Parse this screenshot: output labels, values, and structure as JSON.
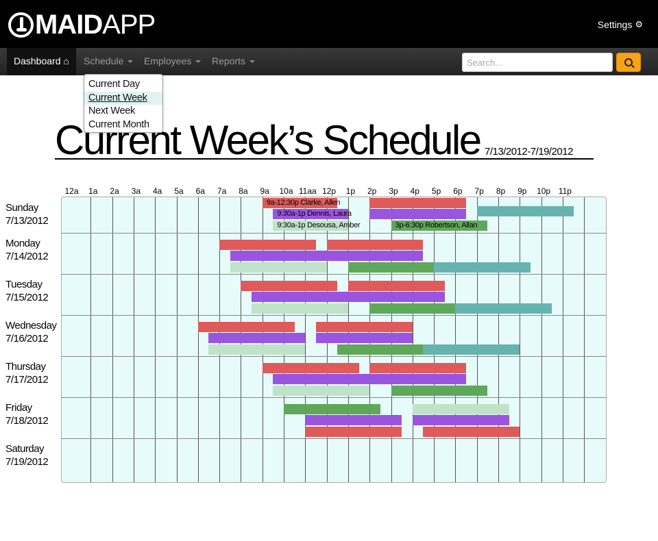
{
  "brand": {
    "name_bold": "MAID",
    "name_light": "APP"
  },
  "header": {
    "settings_label": "Settings",
    "settings_icon": "gear-icon"
  },
  "nav": {
    "items": [
      {
        "label": "Dashboard",
        "icon": "home-icon",
        "active": true
      },
      {
        "label": "Schedule",
        "has_caret": true
      },
      {
        "label": "Employees",
        "has_caret": true
      },
      {
        "label": "Reports",
        "has_caret": true
      }
    ],
    "search_placeholder": "Search...",
    "search_icon": "search-icon"
  },
  "schedule_menu": {
    "items": [
      {
        "label": "Current Day"
      },
      {
        "label": "Current Week",
        "selected": true
      },
      {
        "label": "Next Week"
      },
      {
        "label": "Current Month"
      }
    ]
  },
  "page": {
    "title": "Current Week’s Schedule",
    "date_range": "7/13/2012-7/19/2012"
  },
  "hours": [
    "12a",
    "1a",
    "2a",
    "3a",
    "4a",
    "5a",
    "6a",
    "7a",
    "8a",
    "9a",
    "10a",
    "11aa",
    "12p",
    "1p",
    "2p",
    "3p",
    "4p",
    "5p",
    "6p",
    "7p",
    "8p",
    "9p",
    "10p",
    "11p"
  ],
  "colors": {
    "red": "#e05a5a",
    "purple": "#9a55e0",
    "lightgreen": "#bfe3c8",
    "green": "#5fa85a",
    "teal": "#66b3b0",
    "grid_bg": "#e8fbfb"
  },
  "days": [
    {
      "name": "Sunday",
      "date": "7/13/2012",
      "shifts": [
        {
          "start": 9,
          "end": 12.5,
          "color": "red",
          "label": "9a-12:30p Clarke, Allen"
        },
        {
          "start": 9.5,
          "end": 13,
          "color": "purple",
          "label": "9:30a-1p Dennis, Laura"
        },
        {
          "start": 9.5,
          "end": 13,
          "color": "lightgreen",
          "label": "9:30a-1p Desousa, Amber"
        },
        {
          "start": 14,
          "end": 18.5,
          "color": "red",
          "label": ""
        },
        {
          "start": 14,
          "end": 18.5,
          "color": "purple",
          "label": ""
        },
        {
          "start": 15,
          "end": 19.5,
          "color": "green",
          "label": "3p-6:30p Robertson, Allan"
        },
        {
          "start": 19,
          "end": 23.5,
          "color": "teal",
          "label": ""
        }
      ]
    },
    {
      "name": "Monday",
      "date": "7/14/2012",
      "shifts": [
        {
          "start": 7,
          "end": 11.5,
          "color": "red",
          "label": ""
        },
        {
          "start": 7.5,
          "end": 12,
          "color": "purple",
          "label": ""
        },
        {
          "start": 7.5,
          "end": 12,
          "color": "lightgreen",
          "label": ""
        },
        {
          "start": 12,
          "end": 16.5,
          "color": "red",
          "label": ""
        },
        {
          "start": 12,
          "end": 16.5,
          "color": "purple",
          "label": ""
        },
        {
          "start": 13,
          "end": 17.5,
          "color": "green",
          "label": ""
        },
        {
          "start": 17,
          "end": 21.5,
          "color": "teal",
          "label": ""
        }
      ]
    },
    {
      "name": "Tuesday",
      "date": "7/15/2012",
      "shifts": [
        {
          "start": 8,
          "end": 12.5,
          "color": "red",
          "label": ""
        },
        {
          "start": 8.5,
          "end": 13,
          "color": "purple",
          "label": ""
        },
        {
          "start": 8.5,
          "end": 13,
          "color": "lightgreen",
          "label": ""
        },
        {
          "start": 13,
          "end": 17.5,
          "color": "red",
          "label": ""
        },
        {
          "start": 13,
          "end": 17.5,
          "color": "purple",
          "label": ""
        },
        {
          "start": 14,
          "end": 18.5,
          "color": "green",
          "label": ""
        },
        {
          "start": 18,
          "end": 22.5,
          "color": "teal",
          "label": ""
        }
      ]
    },
    {
      "name": "Wednesday",
      "date": "7/16/2012",
      "shifts": [
        {
          "start": 6,
          "end": 10.5,
          "color": "red",
          "label": ""
        },
        {
          "start": 6.5,
          "end": 11,
          "color": "purple",
          "label": ""
        },
        {
          "start": 6.5,
          "end": 11,
          "color": "lightgreen",
          "label": ""
        },
        {
          "start": 11.5,
          "end": 16,
          "color": "red",
          "label": ""
        },
        {
          "start": 11.5,
          "end": 16,
          "color": "purple",
          "label": ""
        },
        {
          "start": 12.5,
          "end": 17,
          "color": "green",
          "label": ""
        },
        {
          "start": 16.5,
          "end": 21,
          "color": "teal",
          "label": ""
        }
      ]
    },
    {
      "name": "Thursday",
      "date": "7/17/2012",
      "shifts": [
        {
          "start": 9,
          "end": 13.5,
          "color": "red",
          "label": ""
        },
        {
          "start": 9.5,
          "end": 14,
          "color": "purple",
          "label": ""
        },
        {
          "start": 9.5,
          "end": 14,
          "color": "lightgreen",
          "label": ""
        },
        {
          "start": 14,
          "end": 18.5,
          "color": "red",
          "label": ""
        },
        {
          "start": 14,
          "end": 18.5,
          "color": "purple",
          "label": ""
        },
        {
          "start": 15,
          "end": 19.5,
          "color": "green",
          "label": ""
        }
      ]
    },
    {
      "name": "Friday",
      "date": "7/18/2012",
      "shifts": [
        {
          "start": 10,
          "end": 14.5,
          "color": "green",
          "label": ""
        },
        {
          "start": 16,
          "end": 20.5,
          "color": "lightgreen",
          "label": ""
        },
        {
          "start": 11,
          "end": 15.5,
          "color": "purple",
          "label": ""
        },
        {
          "start": 16,
          "end": 20.5,
          "color": "purple",
          "label": ""
        },
        {
          "start": 11,
          "end": 15.5,
          "color": "red",
          "label": ""
        },
        {
          "start": 16.5,
          "end": 21,
          "color": "red",
          "label": ""
        }
      ]
    },
    {
      "name": "Saturday",
      "date": "7/19/2012",
      "shifts": []
    }
  ]
}
